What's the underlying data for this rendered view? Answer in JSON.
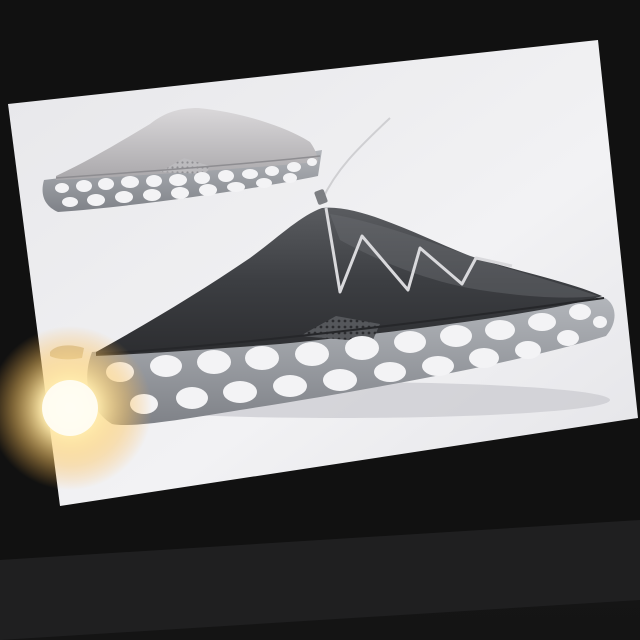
{
  "scene": {
    "subject": "footwear-design-render-on-tablet-screen",
    "colors": {
      "desk": "#1c1c1c",
      "screen_bezel": "#0e0e0e",
      "canvas_paper": "#eeeef1",
      "shoe_upper_dark": "#3f4144",
      "shoe_upper_light": "#c8c6c8",
      "sole_foam": "#9da0a5",
      "sole_cells": "#f3f3f5",
      "glare": "#ffd27a"
    },
    "icons": [
      "lace-icon",
      "mesh-panel-icon",
      "sole-cell-icon"
    ]
  }
}
